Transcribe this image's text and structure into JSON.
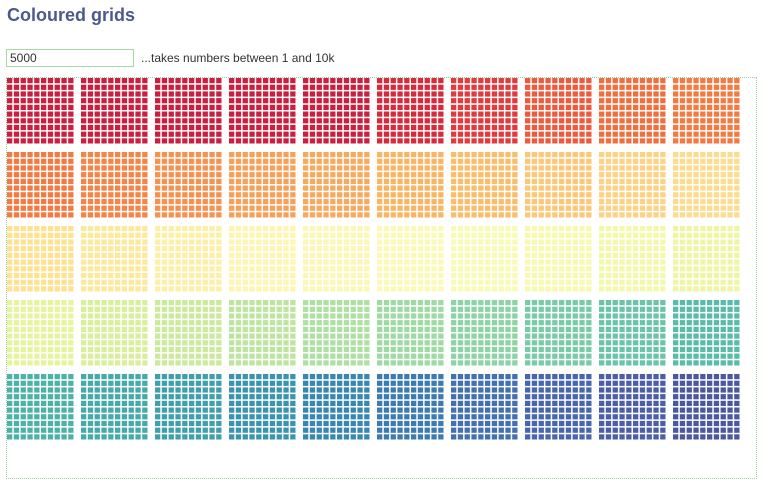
{
  "page": {
    "title": "Coloured grids"
  },
  "controls": {
    "count_value": "5000",
    "count_hint": "...takes numbers between 1 and 10k"
  },
  "grid": {
    "count": 5000,
    "blocks_per_row": 10,
    "block_rows": 5,
    "cells_per_block_side": 10,
    "palette": [
      "#d53e4f",
      "#f46d43",
      "#fdae61",
      "#fee08b",
      "#ffffbf",
      "#e6f598",
      "#abdda4",
      "#66c2a5",
      "#3288bd",
      "#5e4fa2"
    ],
    "colors_by_block_row": [
      [
        "#cc1f3f",
        "#cc1f3f",
        "#cc1f3f",
        "#cc1f3f",
        "#cc1f3f",
        "#d92a3c",
        "#e23b3d",
        "#ee5a3d",
        "#f06f3f",
        "#f47a42"
      ],
      [
        "#f47a42",
        "#f58447",
        "#f7914f",
        "#f9a058",
        "#f9a95d",
        "#fbb462",
        "#fbbd6a",
        "#fcc777",
        "#fdd283",
        "#fddc8d"
      ],
      [
        "#fee28f",
        "#fde99b",
        "#fdefa5",
        "#fdf5b0",
        "#fbf7b4",
        "#fafab6",
        "#f8fbb4",
        "#f6f9ae",
        "#f3f8aa",
        "#eef6a3"
      ],
      [
        "#e6f49d",
        "#d8ef9b",
        "#cbea9c",
        "#bde59f",
        "#ade0a2",
        "#9edaa3",
        "#8cd3a5",
        "#79cba7",
        "#6ac4a8",
        "#59bca9"
      ],
      [
        "#4cb2a8",
        "#45aaa9",
        "#3f9fab",
        "#3a94ad",
        "#3887b0",
        "#3c7bb2",
        "#4270b0",
        "#4766ad",
        "#4c5ea8",
        "#4b579f"
      ]
    ]
  }
}
